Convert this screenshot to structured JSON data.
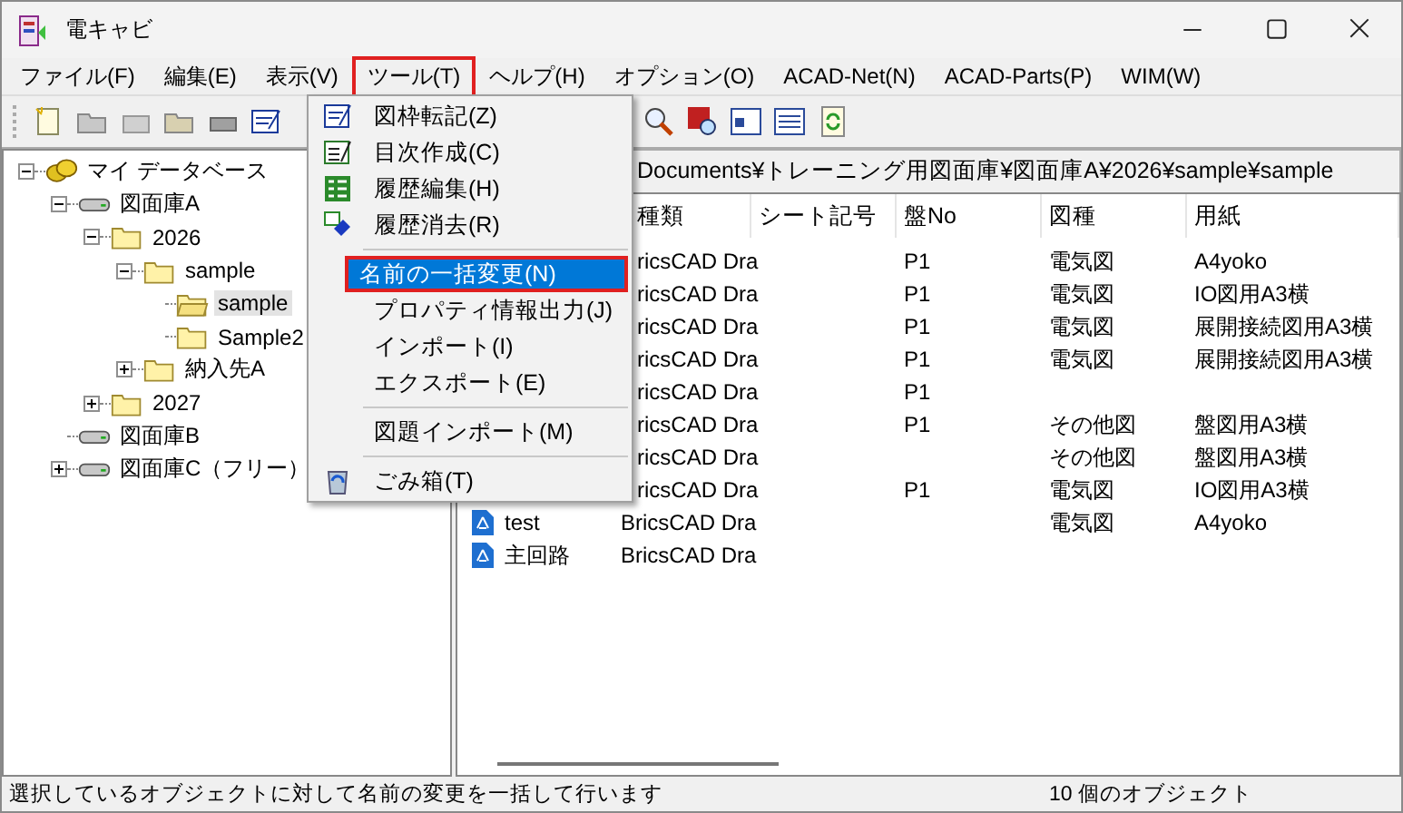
{
  "window": {
    "title": "電キャビ"
  },
  "menu_bar": [
    {
      "label": "ファイル(F)",
      "annotated": false
    },
    {
      "label": "編集(E)",
      "annotated": false
    },
    {
      "label": "表示(V)",
      "annotated": false
    },
    {
      "label": "ツール(T)",
      "annotated": true
    },
    {
      "label": "ヘルプ(H)",
      "annotated": false
    },
    {
      "label": "オプション(O)",
      "annotated": false
    },
    {
      "label": "ACAD-Net(N)",
      "annotated": false
    },
    {
      "label": "ACAD-Parts(P)",
      "annotated": false
    },
    {
      "label": "WIM(W)",
      "annotated": false
    }
  ],
  "tree": [
    {
      "label": "マイ データベース",
      "kind": "database",
      "expanded": true,
      "selected": false,
      "children": [
        {
          "label": "図面庫A",
          "kind": "drive",
          "expanded": true,
          "selected": false,
          "children": [
            {
              "label": "2026",
              "kind": "folder",
              "expanded": true,
              "selected": false,
              "children": [
                {
                  "label": "sample",
                  "kind": "folder",
                  "expanded": true,
                  "selected": false,
                  "children": [
                    {
                      "label": "sample",
                      "kind": "open-folder",
                      "selected": true
                    },
                    {
                      "label": "Sample2",
                      "kind": "folder",
                      "selected": false
                    }
                  ]
                },
                {
                  "label": "納入先A",
                  "kind": "folder",
                  "expanded": false,
                  "selected": false
                }
              ]
            },
            {
              "label": "2027",
              "kind": "folder",
              "expanded": false,
              "selected": false
            }
          ]
        },
        {
          "label": "図面庫B",
          "kind": "drive",
          "selected": false
        },
        {
          "label": "図面庫C（フリー）",
          "kind": "drive",
          "expanded": false,
          "selected": false
        }
      ]
    }
  ],
  "path": "Documents¥トレーニング用図面庫¥図面庫A¥2026¥sample¥sample",
  "table": {
    "columns": [
      "種類",
      "シート記号",
      "盤No",
      "図種",
      "用紙"
    ],
    "rows": [
      {
        "type": "ricsCAD Dra",
        "panel_no": "P1",
        "drawing_kind": "電気図",
        "paper": "A4yoko"
      },
      {
        "type": "ricsCAD Dra",
        "panel_no": "P1",
        "drawing_kind": "電気図",
        "paper": "IO図用A3横"
      },
      {
        "type": "ricsCAD Dra",
        "panel_no": "P1",
        "drawing_kind": "電気図",
        "paper": "展開接続図用A3横"
      },
      {
        "type": "ricsCAD Dra",
        "panel_no": "P1",
        "drawing_kind": "電気図",
        "paper": "展開接続図用A3横"
      },
      {
        "type": "ricsCAD Dra",
        "panel_no": "P1"
      },
      {
        "type": "ricsCAD Dra",
        "panel_no": "P1",
        "drawing_kind": "その他図",
        "paper": "盤図用A3横"
      },
      {
        "type": "ricsCAD Dra",
        "drawing_kind": "その他図",
        "paper": "盤図用A3横"
      },
      {
        "type": "ricsCAD Dra",
        "panel_no": "P1",
        "drawing_kind": "電気図",
        "paper": "IO図用A3横"
      },
      {
        "name": "test",
        "type": "BricsCAD Dra",
        "drawing_kind": "電気図",
        "paper": "A4yoko"
      },
      {
        "name": "主回路",
        "type": "BricsCAD Dra"
      }
    ]
  },
  "tools_menu": [
    {
      "kind": "item",
      "label": "図枠転記(Z)",
      "selected": false,
      "annotated": false
    },
    {
      "kind": "item",
      "label": "目次作成(C)",
      "selected": false,
      "annotated": false
    },
    {
      "kind": "item",
      "label": "履歴編集(H)",
      "selected": false,
      "annotated": false
    },
    {
      "kind": "item",
      "label": "履歴消去(R)",
      "selected": false,
      "annotated": false
    },
    {
      "kind": "separator"
    },
    {
      "kind": "item",
      "label": "名前の一括変更(N)",
      "selected": true,
      "annotated": true
    },
    {
      "kind": "item",
      "label": "プロパティ情報出力(J)",
      "selected": false,
      "annotated": false
    },
    {
      "kind": "item",
      "label": "インポート(I)",
      "selected": false,
      "annotated": false
    },
    {
      "kind": "item",
      "label": "エクスポート(E)",
      "selected": false,
      "annotated": false
    },
    {
      "kind": "separator"
    },
    {
      "kind": "item",
      "label": "図題インポート(M)",
      "selected": false,
      "annotated": false
    },
    {
      "kind": "separator"
    },
    {
      "kind": "item",
      "label": "ごみ箱(T)",
      "selected": false,
      "annotated": false
    }
  ],
  "status_bar": {
    "message": "選択しているオブジェクトに対して名前の変更を一括して行います",
    "count": "10 個のオブジェクト"
  }
}
